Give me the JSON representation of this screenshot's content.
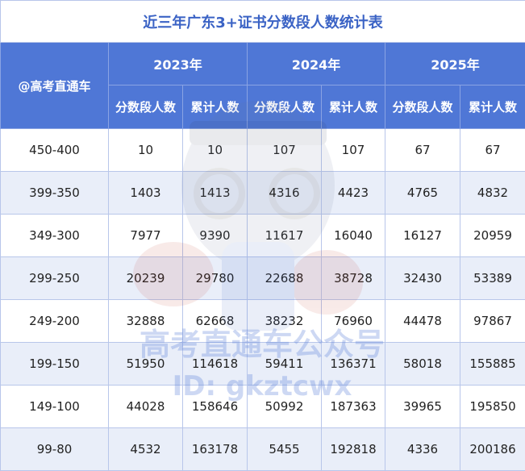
{
  "title": "近三年广东3+证书分数段人数统计表",
  "corner_label": "@高考直通车",
  "years": [
    "2023年",
    "2024年",
    "2025年"
  ],
  "sub_headers": [
    "分数段人数",
    "累计人数"
  ],
  "rows": [
    {
      "range": "450-400",
      "values": [
        "10",
        "10",
        "107",
        "107",
        "67",
        "67"
      ]
    },
    {
      "range": "399-350",
      "values": [
        "1403",
        "1413",
        "4316",
        "4423",
        "4765",
        "4832"
      ]
    },
    {
      "range": "349-300",
      "values": [
        "7977",
        "9390",
        "11617",
        "16040",
        "16127",
        "20959"
      ]
    },
    {
      "range": "299-250",
      "values": [
        "20239",
        "29780",
        "22688",
        "38728",
        "32430",
        "53389"
      ]
    },
    {
      "range": "249-200",
      "values": [
        "32888",
        "62668",
        "38232",
        "76960",
        "44478",
        "97867"
      ]
    },
    {
      "range": "199-150",
      "values": [
        "51950",
        "114618",
        "59411",
        "136371",
        "58018",
        "155885"
      ]
    },
    {
      "range": "149-100",
      "values": [
        "44028",
        "158646",
        "50992",
        "187363",
        "39965",
        "195850"
      ]
    },
    {
      "range": "99-80",
      "values": [
        "4532",
        "163178",
        "5455",
        "192818",
        "4336",
        "200186"
      ]
    }
  ],
  "watermark": {
    "line1": "高考直通车公众号",
    "line2": "ID: gkztcwx"
  },
  "colors": {
    "header_bg": "#4f77d6",
    "title_text": "#3b63c5",
    "alt_row_bg": "#e9eef9",
    "border": "#b8c6ea"
  }
}
